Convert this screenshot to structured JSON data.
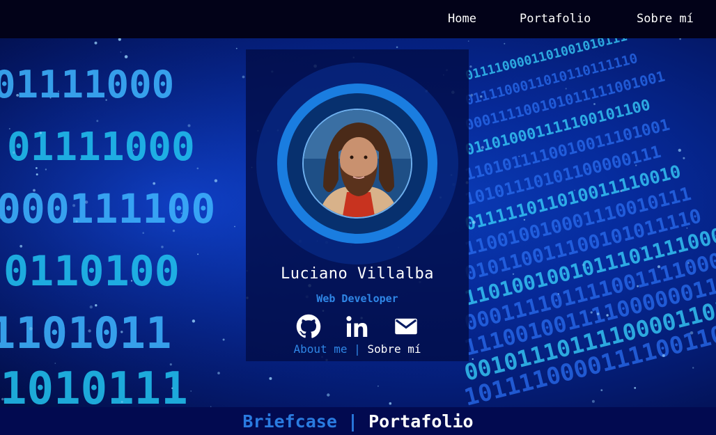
{
  "nav": {
    "home": "Home",
    "portfolio": "Portafolio",
    "about": "Sobre mí"
  },
  "profile": {
    "name": "Luciano Villalba",
    "role": "Web Developer",
    "about_en": "About me",
    "separator": "|",
    "about_es": "Sobre mí"
  },
  "socials": [
    {
      "icon": "github-icon"
    },
    {
      "icon": "linkedin-icon"
    },
    {
      "icon": "mail-icon"
    }
  ],
  "footer": {
    "title_en": "Briefcase",
    "separator": "|",
    "title_es": "Portafolio"
  },
  "colors": {
    "background": "#02021f",
    "accent": "#2f86e6",
    "ring": "#1a7de0",
    "text": "#ffffff"
  },
  "background_digits": [
    "01111000",
    "01111000",
    "000111100",
    "0110100",
    "1101011",
    "1010111",
    "0111110",
    "11001001",
    "0101100",
    "1101001",
    "000111",
    "1110010",
    "0010111",
    "1011110"
  ]
}
